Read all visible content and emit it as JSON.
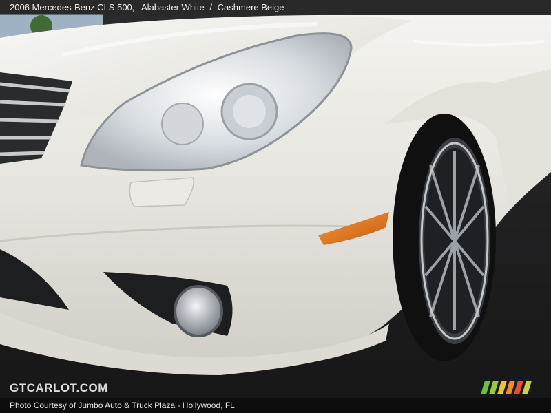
{
  "caption": {
    "vehicle": "2006 Mercedes-Benz CLS 500,",
    "exterior": "Alabaster White",
    "separator": "/",
    "interior": "Cashmere Beige"
  },
  "watermark": {
    "site": "GTCARLOT.COM"
  },
  "credit": {
    "text": "Photo Courtesy of Jumbo Auto & Truck Plaza - Hollywood, FL"
  },
  "logo": {
    "colors": [
      "#6fbf3a",
      "#98c93c",
      "#f2c12e",
      "#f28c28",
      "#e94e2a",
      "#c8d43a"
    ]
  }
}
